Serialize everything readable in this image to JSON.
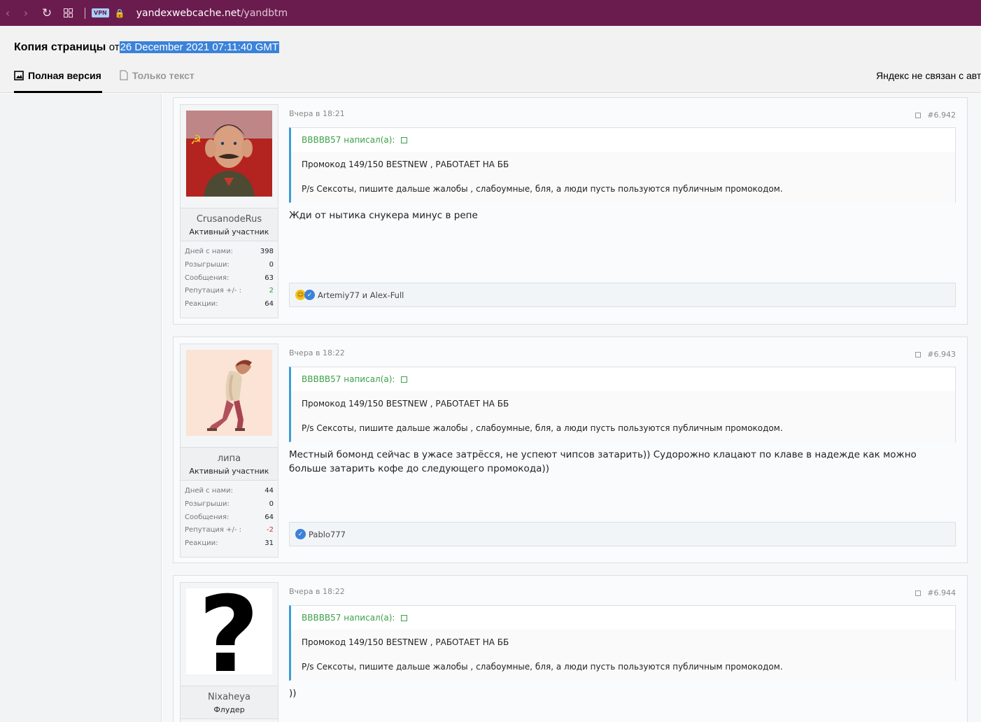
{
  "browser": {
    "url_host": "yandexwebcache.net",
    "url_path": "/yandbtm",
    "vpn_label": "VPN"
  },
  "cache": {
    "title": "Копия страницы",
    "from": "от",
    "date": "26 December 2021 07:11:40 GMT",
    "tab_full": "Полная версия",
    "tab_text": "Только текст",
    "disclaimer": "Яндекс не связан с авт"
  },
  "stat_labels": {
    "days": "Дней с нами:",
    "draws": "Розыгрыши:",
    "messages": "Сообщения:",
    "reputation": "Репутация +/- :",
    "reactions": "Реакции:"
  },
  "posts": [
    {
      "user": "CrusanodeRus",
      "rank": "Активный участник",
      "days": "398",
      "draws": "0",
      "messages": "63",
      "reputation": "2",
      "reactions": "64",
      "date": "Вчера в 18:21",
      "number": "#6.942",
      "quote_author": "BBBBB57 написал(а):",
      "quote_line1": "Промокод 149/150 BESTNEW , РАБОТАЕТ НА ББ",
      "quote_line2": "P/s Сексоты, пишите дальше жалобы , слабоумные, бля, а люди пусть пользуются публичным промокодом.",
      "text": "Жди от нытика снукера минус в репе",
      "reacted_by": "Artemiy77 и Alex-Full"
    },
    {
      "user": "липа",
      "rank": "Активный участник",
      "days": "44",
      "draws": "0",
      "messages": "64",
      "reputation": "-2",
      "reactions": "31",
      "date": "Вчера в 18:22",
      "number": "#6.943",
      "quote_author": "BBBBB57 написал(а):",
      "quote_line1": "Промокод 149/150 BESTNEW , РАБОТАЕТ НА ББ",
      "quote_line2": "P/s Сексоты, пишите дальше жалобы , слабоумные, бля, а люди пусть пользуются публичным промокодом.",
      "text": "Местный бомонд сейчас в ужасе затрёсся, не успеют чипсов затарить)) Судорожно клацают по клаве в надежде как можно больше затарить кофе до следующего промокода))",
      "reacted_by": "Pablo777"
    },
    {
      "user": "Nixaheya",
      "rank": "Флудер",
      "date": "Вчера в 18:22",
      "number": "#6.944",
      "quote_author": "BBBBB57 написал(а):",
      "quote_line1": "Промокод 149/150 BESTNEW , РАБОТАЕТ НА ББ",
      "quote_line2": "P/s Сексоты, пишите дальше жалобы , слабоумные, бля, а люди пусть пользуются публичным промокодом.",
      "text": "))"
    }
  ]
}
